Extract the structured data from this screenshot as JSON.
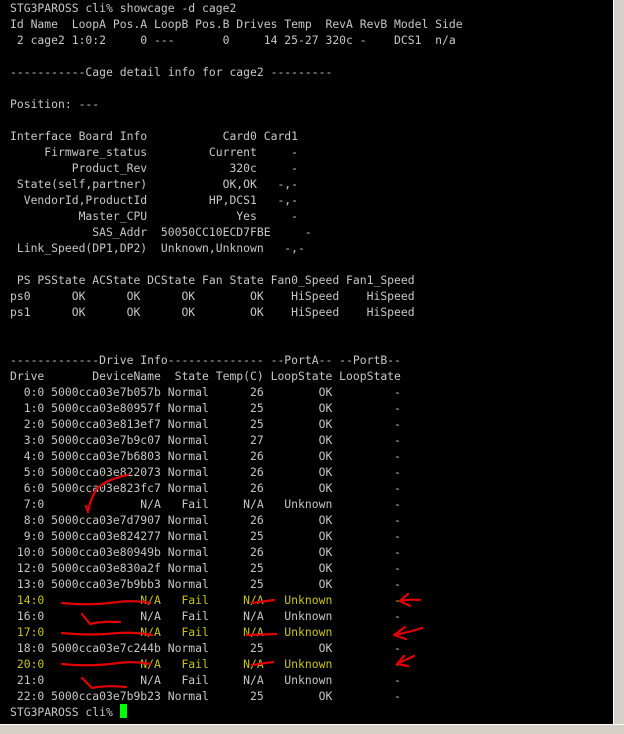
{
  "terminal": {
    "lines": [
      {
        "text": "STG3PAROSS cli% showcage -d cage2",
        "hl": false
      },
      {
        "text": "Id Name  LoopA Pos.A LoopB Pos.B Drives Temp  RevA RevB Model Side",
        "hl": false
      },
      {
        "text": " 2 cage2 1:0:2     0 ---       0     14 25-27 320c -    DCS1  n/a",
        "hl": false
      },
      {
        "text": "",
        "hl": false
      },
      {
        "text": "-----------Cage detail info for cage2 ---------",
        "hl": false
      },
      {
        "text": "",
        "hl": false
      },
      {
        "text": "Position: ---",
        "hl": false
      },
      {
        "text": "",
        "hl": false
      },
      {
        "text": "Interface Board Info           Card0 Card1",
        "hl": false
      },
      {
        "text": "     Firmware_status         Current     -",
        "hl": false
      },
      {
        "text": "         Product_Rev            320c     -",
        "hl": false
      },
      {
        "text": " State(self,partner)           OK,OK   -,-",
        "hl": false
      },
      {
        "text": "  VendorId,ProductId         HP,DCS1   -,-",
        "hl": false
      },
      {
        "text": "          Master_CPU             Yes     -",
        "hl": false
      },
      {
        "text": "            SAS_Addr  50050CC10ECD7FBE     -",
        "hl": false
      },
      {
        "text": " Link_Speed(DP1,DP2)  Unknown,Unknown   -,-",
        "hl": false
      },
      {
        "text": "",
        "hl": false
      },
      {
        "text": " PS PSState ACState DCState Fan State Fan0_Speed Fan1_Speed",
        "hl": false
      },
      {
        "text": "ps0      OK      OK      OK        OK    HiSpeed    HiSpeed",
        "hl": false
      },
      {
        "text": "ps1      OK      OK      OK        OK    HiSpeed    HiSpeed",
        "hl": false
      },
      {
        "text": "",
        "hl": false
      },
      {
        "text": "",
        "hl": false
      },
      {
        "text": "-------------Drive Info-------------- --PortA-- --PortB--",
        "hl": false
      },
      {
        "text": "Drive       DeviceName  State Temp(C) LoopState LoopState",
        "hl": false
      },
      {
        "text": "  0:0 5000cca03e7b057b Normal      26        OK         -",
        "hl": false
      },
      {
        "text": "  1:0 5000cca03e80957f Normal      25        OK         -",
        "hl": false
      },
      {
        "text": "  2:0 5000cca03e813ef7 Normal      25        OK         -",
        "hl": false
      },
      {
        "text": "  3:0 5000cca03e7b9c07 Normal      27        OK         -",
        "hl": false
      },
      {
        "text": "  4:0 5000cca03e7b6803 Normal      26        OK         -",
        "hl": false
      },
      {
        "text": "  5:0 5000cca03e822073 Normal      26        OK         -",
        "hl": false
      },
      {
        "text": "  6:0 5000cca03e823fc7 Normal      26        OK         -",
        "hl": false
      },
      {
        "text": "  7:0              N/A   Fail     N/A   Unknown         -",
        "hl": false
      },
      {
        "text": "  8:0 5000cca03e7d7907 Normal      26        OK         -",
        "hl": false
      },
      {
        "text": "  9:0 5000cca03e824277 Normal      25        OK         -",
        "hl": false
      },
      {
        "text": " 10:0 5000cca03e80949b Normal      26        OK         -",
        "hl": false
      },
      {
        "text": " 12:0 5000cca03e830a2f Normal      25        OK         -",
        "hl": false
      },
      {
        "text": " 13:0 5000cca03e7b9bb3 Normal      25        OK         -",
        "hl": false
      },
      {
        "text": " 14:0              N/A   Fail     N/A   Unknown         -",
        "hl": true
      },
      {
        "text": " 16:0              N/A   Fail     N/A   Unknown         -",
        "hl": false
      },
      {
        "text": " 17:0              N/A   Fail     N/A   Unknown         -",
        "hl": true
      },
      {
        "text": " 18:0 5000cca03e7c244b Normal      25        OK         -",
        "hl": false
      },
      {
        "text": " 20:0              N/A   Fail     N/A   Unknown         -",
        "hl": true
      },
      {
        "text": " 21:0              N/A   Fail     N/A   Unknown         -",
        "hl": false
      },
      {
        "text": " 22:0 5000cca03e7b9b23 Normal      25        OK         -",
        "hl": false
      }
    ],
    "prompt": "STG3PAROSS cli% ",
    "colors": {
      "background": "#000000",
      "text": "#c7c7c7",
      "highlight": "#c9c21a",
      "cursor": "#00ff00",
      "annotation": "#e30000"
    }
  }
}
